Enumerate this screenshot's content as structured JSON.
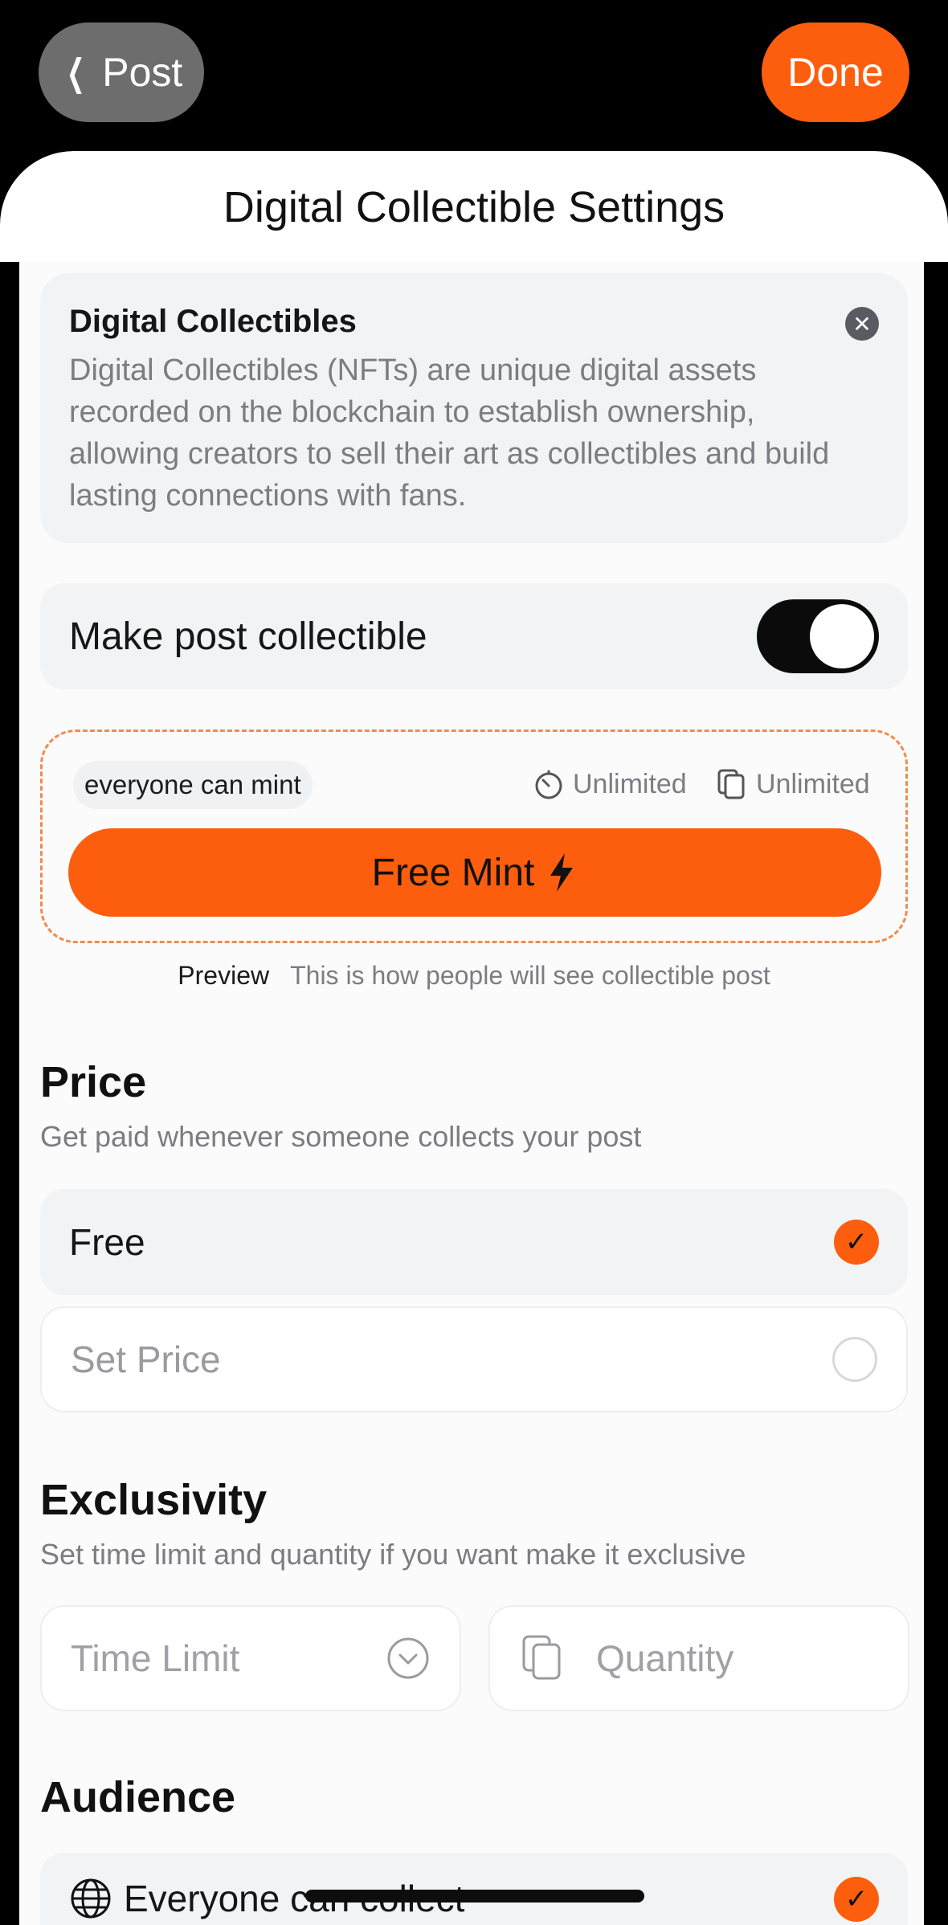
{
  "nav": {
    "back_label": "Post",
    "done_label": "Done"
  },
  "sheet": {
    "title": "Digital Collectible Settings"
  },
  "info": {
    "title": "Digital Collectibles",
    "body": "Digital Collectibles (NFTs) are unique digital assets recorded on the blockchain to establish ownership, allowing creators to sell their art as collectibles and build lasting connections with fans."
  },
  "collectible_toggle": {
    "label": "Make post collectible",
    "on": true
  },
  "preview": {
    "chip": "everyone can mint",
    "time_limit": "Unlimited",
    "quantity": "Unlimited",
    "button_label": "Free Mint",
    "caption_lead": "Preview",
    "caption_rest": "This is how people will see collectible post"
  },
  "price": {
    "title": "Price",
    "subtitle": "Get paid whenever someone collects your post",
    "options": [
      {
        "label": "Free",
        "selected": true
      },
      {
        "label": "Set Price",
        "selected": false
      }
    ]
  },
  "exclusivity": {
    "title": "Exclusivity",
    "subtitle": "Set time limit and quantity if you want make it exclusive",
    "time_limit_placeholder": "Time Limit",
    "quantity_placeholder": "Quantity"
  },
  "audience": {
    "title": "Audience",
    "first_option": "Everyone can collect",
    "first_selected": true
  },
  "colors": {
    "accent": "#fd5e0d",
    "background": "#000000",
    "card": "#f2f3f5"
  }
}
